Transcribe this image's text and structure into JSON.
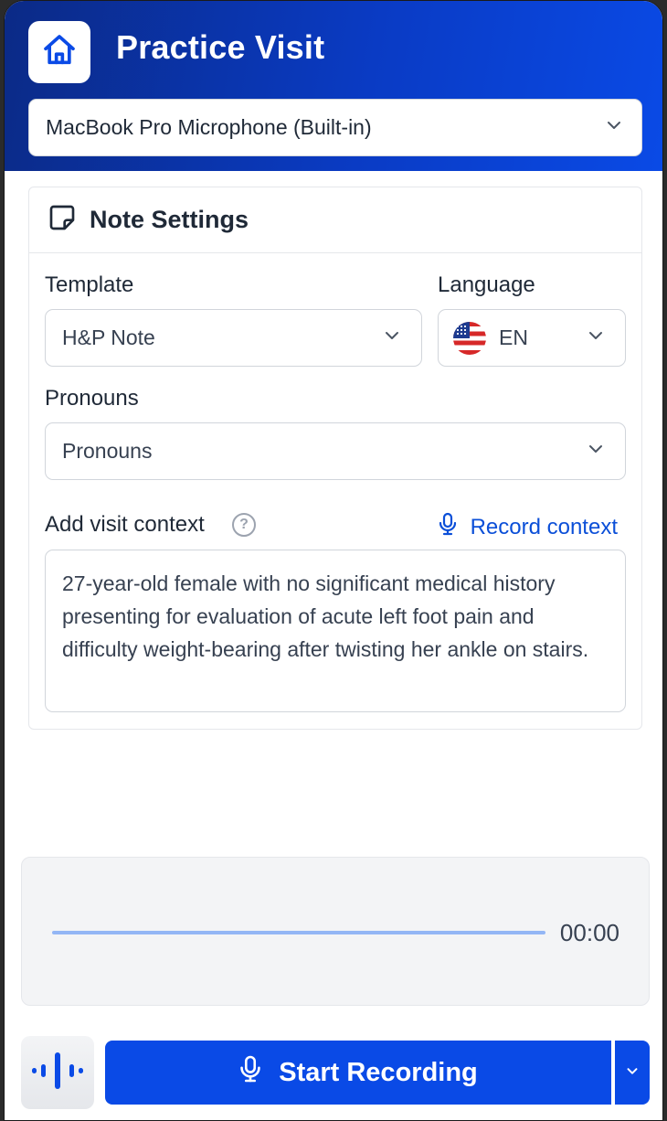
{
  "header": {
    "title": "Practice Visit",
    "microphone": {
      "selected": "MacBook Pro Microphone (Built-in)"
    }
  },
  "note_settings": {
    "title": "Note Settings",
    "template": {
      "label": "Template",
      "selected": "H&P Note"
    },
    "language": {
      "label": "Language",
      "selected": "EN"
    },
    "pronouns": {
      "label": "Pronouns",
      "selected": "Pronouns"
    },
    "context": {
      "label": "Add visit context",
      "record_label": "Record context",
      "value": "27-year-old female with no significant medical history presenting for evaluation of acute left foot pain and difficulty weight-bearing after twisting her ankle on stairs."
    }
  },
  "recorder": {
    "timer": "00:00"
  },
  "footer": {
    "start_label": "Start Recording"
  },
  "colors": {
    "brand": "#0a4ae6",
    "header_dark": "#0b2a86",
    "link": "#0b4fd8"
  },
  "icons": [
    "home-icon",
    "chevron-down-icon",
    "note-icon",
    "help-icon",
    "microphone-icon",
    "waveform-icon",
    "us-flag-icon"
  ]
}
